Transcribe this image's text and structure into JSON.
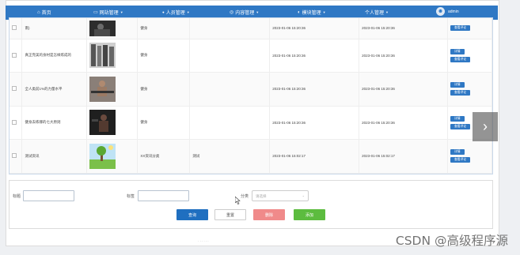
{
  "nav": {
    "items": [
      {
        "label": "首页",
        "icon": "home-icon",
        "glyph": "⌂",
        "dropdown": false
      },
      {
        "label": "网站管理",
        "icon": "monitor-icon",
        "glyph": "▭",
        "dropdown": true
      },
      {
        "label": "人员管理",
        "icon": "user-icon",
        "glyph": "●",
        "dropdown": true
      },
      {
        "label": "内容管理",
        "icon": "globe-icon",
        "glyph": "◎",
        "dropdown": true
      },
      {
        "label": "模块管理",
        "icon": "message-icon",
        "glyph": "◐",
        "dropdown": true
      },
      {
        "label": "个人管理",
        "icon": "",
        "glyph": "",
        "dropdown": true
      }
    ],
    "username": "admin",
    "color": "#2f78c4"
  },
  "table": {
    "rows": [
      {
        "title": "南)",
        "category": "健身",
        "tag": "",
        "created": "2023-01-06 15:20:36",
        "updated": "2023-01-06 15:20:36",
        "actions": [
          "查看评论"
        ]
      },
      {
        "title": "真正完美的身材是怎样炼成的",
        "category": "健身",
        "tag": "",
        "created": "2023-01-06 15:20:36",
        "updated": "2023-01-06 15:20:36",
        "actions": [
          "详情",
          "查看评论"
        ]
      },
      {
        "title": "全人类前1%的力量水平",
        "category": "健身",
        "tag": "",
        "created": "2023-01-06 15:20:36",
        "updated": "2023-01-06 15:20:36",
        "actions": [
          "详情",
          "查看评论"
        ]
      },
      {
        "title": "健身去练哪的七大原则",
        "category": "健身",
        "tag": "",
        "created": "2023-01-06 15:20:36",
        "updated": "2023-01-06 15:20:36",
        "actions": [
          "详情",
          "查看评论"
        ]
      },
      {
        "title": "测试资讯",
        "category": "XX资讯分类",
        "tag": "测试",
        "created": "2023-01-06 15:02:17",
        "updated": "2023-01-06 15:02:17",
        "actions": [
          "详情",
          "查看评论"
        ]
      }
    ]
  },
  "filter": {
    "title_label": "标题",
    "tag_label": "标签",
    "category_label": "分类",
    "category_placeholder": "请选择",
    "buttons": {
      "search": "查询",
      "reset": "重置",
      "delete": "删除",
      "add": "添加"
    }
  },
  "colors": {
    "primary": "#2f78c4",
    "search": "#1f6fc0",
    "delete": "#f08a8a",
    "add": "#5cbc3f"
  },
  "watermark": "CSDN @高级程序源"
}
